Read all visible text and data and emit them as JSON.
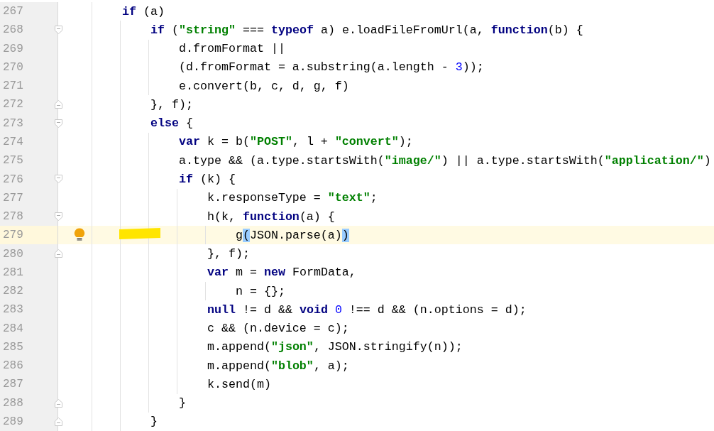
{
  "editor": {
    "lines": [
      {
        "number": "267",
        "current": false,
        "fold_open": false,
        "fold_close": false,
        "tokens": [
          {
            "kind": "kw",
            "text": "    if"
          },
          {
            "kind": "txt",
            "text": " (a)"
          }
        ]
      },
      {
        "number": "268",
        "current": false,
        "fold_open": true,
        "fold_close": false,
        "tokens": [
          {
            "kind": "kw",
            "text": "        if"
          },
          {
            "kind": "txt",
            "text": " ("
          },
          {
            "kind": "str",
            "text": "\"string\""
          },
          {
            "kind": "txt",
            "text": " === "
          },
          {
            "kind": "kw",
            "text": "typeof"
          },
          {
            "kind": "txt",
            "text": " a) e.loadFileFromUrl(a, "
          },
          {
            "kind": "kw",
            "text": "function"
          },
          {
            "kind": "txt",
            "text": "(b) {"
          }
        ]
      },
      {
        "number": "269",
        "current": false,
        "fold_open": false,
        "fold_close": false,
        "tokens": [
          {
            "kind": "txt",
            "text": "            d.fromFormat ||"
          }
        ]
      },
      {
        "number": "270",
        "current": false,
        "fold_open": false,
        "fold_close": false,
        "tokens": [
          {
            "kind": "txt",
            "text": "            (d.fromFormat = a.substring(a.length - "
          },
          {
            "kind": "num",
            "text": "3"
          },
          {
            "kind": "txt",
            "text": "));"
          }
        ]
      },
      {
        "number": "271",
        "current": false,
        "fold_open": false,
        "fold_close": false,
        "tokens": [
          {
            "kind": "txt",
            "text": "            e.convert(b, c, d, g, f)"
          }
        ]
      },
      {
        "number": "272",
        "current": false,
        "fold_open": false,
        "fold_close": true,
        "tokens": [
          {
            "kind": "txt",
            "text": "        }, f);"
          }
        ]
      },
      {
        "number": "273",
        "current": false,
        "fold_open": true,
        "fold_close": false,
        "tokens": [
          {
            "kind": "kw",
            "text": "        else"
          },
          {
            "kind": "txt",
            "text": " {"
          }
        ]
      },
      {
        "number": "274",
        "current": false,
        "fold_open": false,
        "fold_close": false,
        "tokens": [
          {
            "kind": "kw",
            "text": "            var"
          },
          {
            "kind": "txt",
            "text": " k = b("
          },
          {
            "kind": "str",
            "text": "\"POST\""
          },
          {
            "kind": "txt",
            "text": ", l + "
          },
          {
            "kind": "str",
            "text": "\"convert\""
          },
          {
            "kind": "txt",
            "text": ");"
          }
        ]
      },
      {
        "number": "275",
        "current": false,
        "fold_open": false,
        "fold_close": false,
        "tokens": [
          {
            "kind": "txt",
            "text": "            a.type && (a.type.startsWith("
          },
          {
            "kind": "str",
            "text": "\"image/\""
          },
          {
            "kind": "txt",
            "text": ") || a.type.startsWith("
          },
          {
            "kind": "str",
            "text": "\"application/\""
          },
          {
            "kind": "txt",
            "text": ")"
          }
        ]
      },
      {
        "number": "276",
        "current": false,
        "fold_open": true,
        "fold_close": false,
        "tokens": [
          {
            "kind": "kw",
            "text": "            if"
          },
          {
            "kind": "txt",
            "text": " (k) {"
          }
        ]
      },
      {
        "number": "277",
        "current": false,
        "fold_open": false,
        "fold_close": false,
        "tokens": [
          {
            "kind": "txt",
            "text": "                k.responseType = "
          },
          {
            "kind": "str",
            "text": "\"text\""
          },
          {
            "kind": "txt",
            "text": ";"
          }
        ]
      },
      {
        "number": "278",
        "current": false,
        "fold_open": true,
        "fold_close": false,
        "tokens": [
          {
            "kind": "txt",
            "text": "                h(k, "
          },
          {
            "kind": "kw",
            "text": "function"
          },
          {
            "kind": "txt",
            "text": "(a) {"
          }
        ]
      },
      {
        "number": "279",
        "current": true,
        "fold_open": false,
        "fold_close": false,
        "bulb": true,
        "highlighter": true,
        "tokens": [
          {
            "kind": "txt",
            "text": "                    g"
          },
          {
            "kind": "match",
            "text": "("
          },
          {
            "kind": "txt",
            "text": "JSON.parse(a)"
          },
          {
            "kind": "match",
            "text": ")"
          }
        ]
      },
      {
        "number": "280",
        "current": false,
        "fold_open": false,
        "fold_close": true,
        "tokens": [
          {
            "kind": "txt",
            "text": "                }, f);"
          }
        ]
      },
      {
        "number": "281",
        "current": false,
        "fold_open": false,
        "fold_close": false,
        "tokens": [
          {
            "kind": "kw",
            "text": "                var"
          },
          {
            "kind": "txt",
            "text": " m = "
          },
          {
            "kind": "kw",
            "text": "new"
          },
          {
            "kind": "txt",
            "text": " FormData,"
          }
        ]
      },
      {
        "number": "282",
        "current": false,
        "fold_open": false,
        "fold_close": false,
        "tokens": [
          {
            "kind": "txt",
            "text": "                    n = {};"
          }
        ]
      },
      {
        "number": "283",
        "current": false,
        "fold_open": false,
        "fold_close": false,
        "tokens": [
          {
            "kind": "kw",
            "text": "                null"
          },
          {
            "kind": "txt",
            "text": " != d && "
          },
          {
            "kind": "kw",
            "text": "void "
          },
          {
            "kind": "num",
            "text": "0"
          },
          {
            "kind": "txt",
            "text": " !== d && (n.options = d);"
          }
        ]
      },
      {
        "number": "284",
        "current": false,
        "fold_open": false,
        "fold_close": false,
        "tokens": [
          {
            "kind": "txt",
            "text": "                c && (n.device = c);"
          }
        ]
      },
      {
        "number": "285",
        "current": false,
        "fold_open": false,
        "fold_close": false,
        "tokens": [
          {
            "kind": "txt",
            "text": "                m.append("
          },
          {
            "kind": "str",
            "text": "\"json\""
          },
          {
            "kind": "txt",
            "text": ", JSON.stringify(n));"
          }
        ]
      },
      {
        "number": "286",
        "current": false,
        "fold_open": false,
        "fold_close": false,
        "tokens": [
          {
            "kind": "txt",
            "text": "                m.append("
          },
          {
            "kind": "str",
            "text": "\"blob\""
          },
          {
            "kind": "txt",
            "text": ", a);"
          }
        ]
      },
      {
        "number": "287",
        "current": false,
        "fold_open": false,
        "fold_close": false,
        "tokens": [
          {
            "kind": "txt",
            "text": "                k.send(m)"
          }
        ]
      },
      {
        "number": "288",
        "current": false,
        "fold_open": false,
        "fold_close": true,
        "tokens": [
          {
            "kind": "txt",
            "text": "            }"
          }
        ]
      },
      {
        "number": "289",
        "current": false,
        "fold_open": false,
        "fold_close": true,
        "tokens": [
          {
            "kind": "txt",
            "text": "        }"
          }
        ]
      }
    ]
  }
}
